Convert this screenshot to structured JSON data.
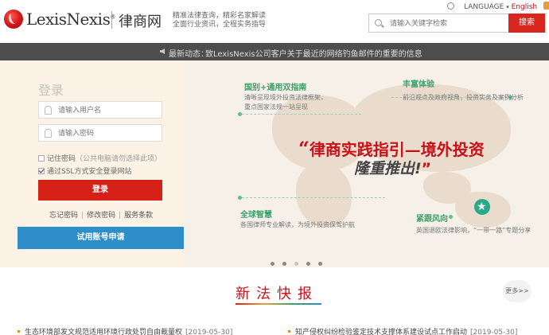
{
  "header": {
    "brand": "LexisNexis",
    "brand_mark": "®",
    "brand_cn": "律商网",
    "slogan_line1": "精准法律查询，精彩名家解读",
    "slogan_line2": "全面行业资讯，全程实务指导",
    "language_label": "LANGUAGE",
    "language_english": "English",
    "search_placeholder": "请输入关键字检索",
    "search_button": "搜索"
  },
  "notice": {
    "label": "最新动态：",
    "text": "致LexisNexis公司客户关于最近的网络钓鱼邮件的重要的信息"
  },
  "login": {
    "title": "登录",
    "username_placeholder": "请输入用户名",
    "password_placeholder": "请输入密码",
    "remember_label": "记住密码",
    "remember_hint": "（公共电脑请勿选择此项）",
    "ssl_label": "通过SSL方式安全登录网站",
    "login_button": "登录",
    "forgot_link": "忘记密码",
    "change_link": "修改密码",
    "terms_link": "服务条款",
    "trial_button": "试用账号申请"
  },
  "banner": {
    "features": [
      {
        "title": "国别+通用双指南",
        "desc1": "清晰呈现境外投资法律框架，",
        "desc2": "重点国家法规一站呈现"
      },
      {
        "title": "丰富体验",
        "desc1": "前沿观点及政府视角，投资实务及案例分析",
        "desc2": ""
      },
      {
        "title": "全球智慧",
        "desc1": "各国律师专业解读，为境外投资保驾护航",
        "desc2": ""
      },
      {
        "title": "紧跟风向",
        "desc1": "英国退欧法律影响，“一带一路”专题分享",
        "desc2": ""
      }
    ],
    "headline_open": "“",
    "headline": "律商实践指引—境外投资",
    "subline": "隆重推出!",
    "headline_close": "”",
    "slide_count": 5,
    "active_slide": 3
  },
  "news": {
    "title": "新法快报",
    "more": "更多>>",
    "items": [
      {
        "title": "生态环境部发文规范适用环境行政处罚自由裁量权",
        "date": "[2019-05-30]"
      },
      {
        "title": "知产侵权纠纷检验鉴定技术支撑体系建设试点工作启动",
        "date": "[2019-05-30]"
      }
    ]
  }
}
